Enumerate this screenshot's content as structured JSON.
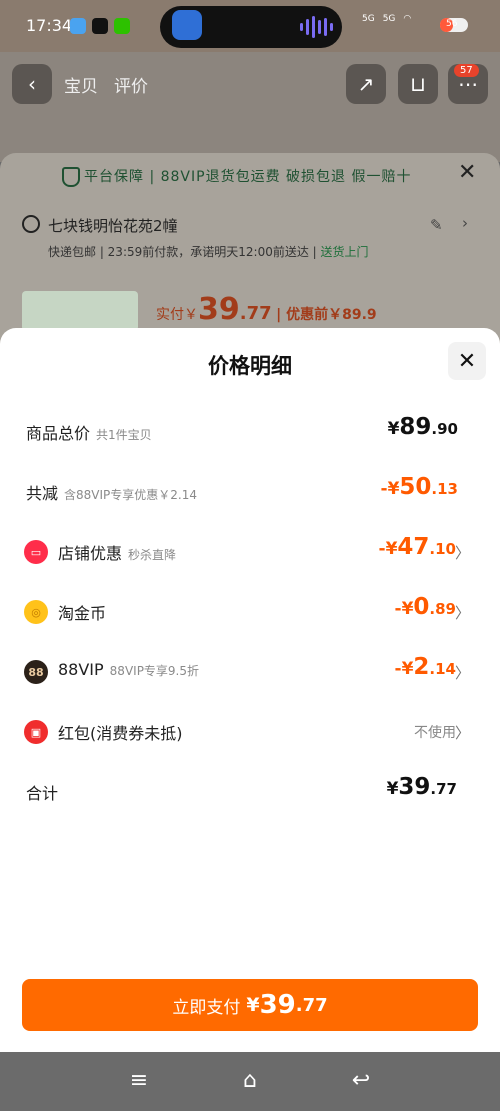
{
  "status": {
    "time": "17:34",
    "signal1": "5G",
    "signal2": "5G",
    "battery": "56"
  },
  "product_nav": {
    "tab_product": "宝贝",
    "tab_reviews": "评价",
    "cart_badge": "57"
  },
  "under_sheet": {
    "guarantee": "平台保障 | 88VIP退货包运费 破损包退 假一赔十",
    "address": "七块钱明怡花苑2幢",
    "delivery": "快递包邮 | 23:59前付款，承诺明天12:00前送达 |",
    "delivery_green": "送货上门",
    "paid_label": "实付￥",
    "paid_int": "39",
    "paid_dec": ".77",
    "before_label": "| 优惠前￥89.9"
  },
  "sheet": {
    "title": "价格明细",
    "rows": [
      {
        "label": "商品总价",
        "sub": "共1件宝贝",
        "cur": "¥",
        "int": "89",
        "dec": ".90"
      },
      {
        "label": "共减",
        "sub": "含88VIP专享优惠￥2.14",
        "cur": "-¥",
        "int": "50",
        "dec": ".13"
      },
      {
        "label": "店铺优惠",
        "sub": "秒杀直降",
        "cur": "-¥",
        "int": "47",
        "dec": ".10"
      },
      {
        "label": "淘金币",
        "sub": "",
        "cur": "-¥",
        "int": "0",
        "dec": ".89"
      },
      {
        "label": "88VIP",
        "sub": "88VIP专享9.5折",
        "cur": "-¥",
        "int": "2",
        "dec": ".14",
        "icon_text": "88"
      },
      {
        "label": "红包(消费券未抵)",
        "sub": "",
        "value": "不使用"
      },
      {
        "label": "合计",
        "sub": "",
        "cur": "¥",
        "int": "39",
        "dec": ".77"
      }
    ],
    "pay_button": {
      "label": "立即支付",
      "cur": "¥",
      "int": "39",
      "dec": ".77"
    }
  },
  "colors": {
    "accent": "#ff6a00",
    "discount": "#ff5a00",
    "green": "#1e6f3a"
  },
  "icons": [
    "back-icon",
    "share-icon",
    "cart-icon",
    "more-icon",
    "shield-icon",
    "close-icon",
    "location-pin-icon",
    "edit-icon",
    "store-icon",
    "coin-icon",
    "vip-icon",
    "red-packet-icon",
    "chevron-right-icon",
    "menu-icon",
    "home-icon",
    "return-icon"
  ]
}
